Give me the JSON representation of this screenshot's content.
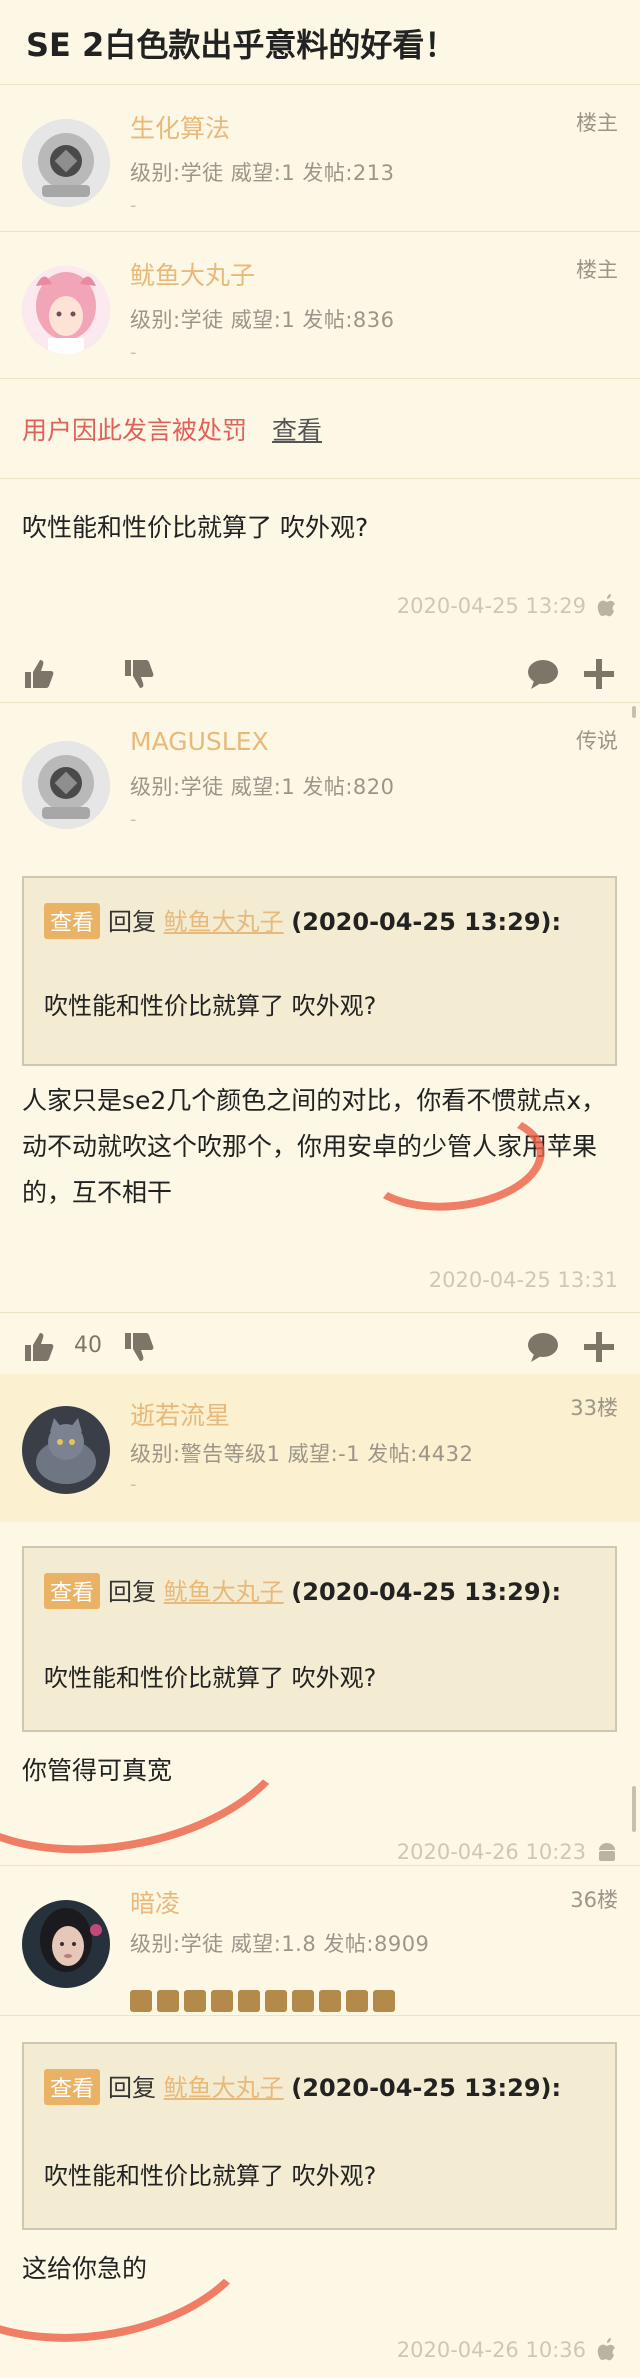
{
  "thread": {
    "title": "SE 2白色款出乎意料的好看！"
  },
  "users": [
    {
      "name": "生化算法",
      "meta": "级别:学徒  威望:1  发帖:213",
      "dash": "-",
      "floor": "楼主",
      "avatar": "diving-helmet"
    },
    {
      "name": "鱿鱼大丸子",
      "meta": "级别:学徒  威望:1  发帖:836",
      "dash": "-",
      "floor": "楼主",
      "avatar": "anime-girl-pink-hair"
    },
    {
      "name": "MAGUSLEX",
      "meta": "级别:学徒  威望:1  发帖:820",
      "dash": "-",
      "floor": "传说",
      "avatar": "diving-helmet"
    },
    {
      "name": "逝若流星",
      "meta": "级别:警告等级1  威望:-1  发帖:4432",
      "dash": "-",
      "floor": "33楼",
      "avatar": "grey-cat"
    },
    {
      "name": "暗凌",
      "meta": "级别:学徒  威望:1.8  发帖:8909",
      "floor": "36楼",
      "avatar": "girl-portrait"
    }
  ],
  "punish": {
    "text": "用户因此发言被处罚",
    "link": "查看"
  },
  "posts": [
    {
      "text": "吹性能和性价比就算了 吹外观?",
      "time": "2020-04-25 13:29",
      "device": "apple-icon"
    },
    {
      "text": "人家只是se2几个颜色之间的对比，你看不惯就点x，动不动就吹这个吹那个，你用安卓的少管人家用苹果的，互不相干",
      "time": "2020-04-25 13:31",
      "likes": "40"
    },
    {
      "text": "你管得可真宽",
      "time": "2020-04-26 10:23",
      "device": "android-icon"
    },
    {
      "text": "这给你急的",
      "time": "2020-04-26 10:36",
      "device": "apple-icon"
    }
  ],
  "quote": {
    "tag": "查看",
    "reply": "回复",
    "target": "鱿鱼大丸子",
    "date": "(2020-04-25 13:29):",
    "text": "吹性能和性价比就算了 吹外观?"
  },
  "colors": {
    "accent": "#e8b97a",
    "background": "#fdf8e6",
    "punish": "#e0605a",
    "annotation": "#ec6045"
  }
}
